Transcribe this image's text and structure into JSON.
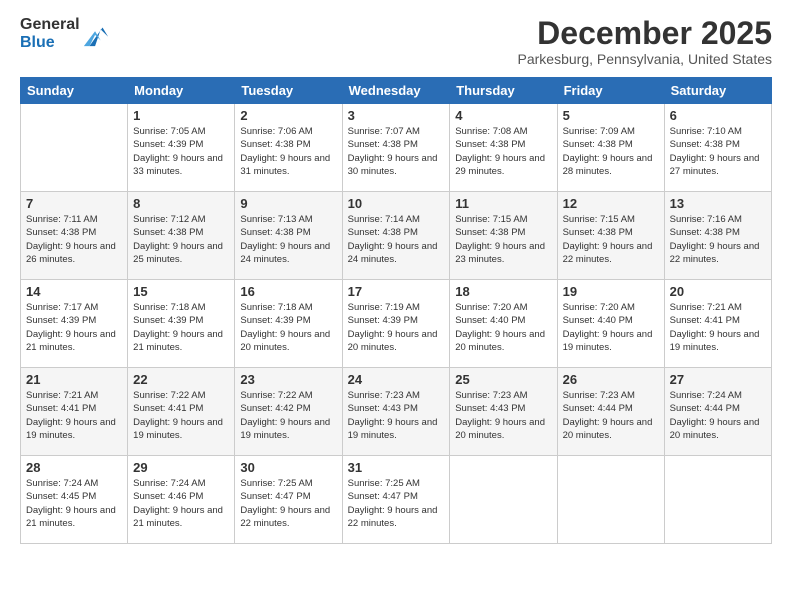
{
  "header": {
    "logo_line1": "General",
    "logo_line2": "Blue",
    "month": "December 2025",
    "location": "Parkesburg, Pennsylvania, United States"
  },
  "days_of_week": [
    "Sunday",
    "Monday",
    "Tuesday",
    "Wednesday",
    "Thursday",
    "Friday",
    "Saturday"
  ],
  "weeks": [
    [
      {
        "day": "",
        "sunrise": "",
        "sunset": "",
        "daylight": ""
      },
      {
        "day": "1",
        "sunrise": "Sunrise: 7:05 AM",
        "sunset": "Sunset: 4:39 PM",
        "daylight": "Daylight: 9 hours and 33 minutes."
      },
      {
        "day": "2",
        "sunrise": "Sunrise: 7:06 AM",
        "sunset": "Sunset: 4:38 PM",
        "daylight": "Daylight: 9 hours and 31 minutes."
      },
      {
        "day": "3",
        "sunrise": "Sunrise: 7:07 AM",
        "sunset": "Sunset: 4:38 PM",
        "daylight": "Daylight: 9 hours and 30 minutes."
      },
      {
        "day": "4",
        "sunrise": "Sunrise: 7:08 AM",
        "sunset": "Sunset: 4:38 PM",
        "daylight": "Daylight: 9 hours and 29 minutes."
      },
      {
        "day": "5",
        "sunrise": "Sunrise: 7:09 AM",
        "sunset": "Sunset: 4:38 PM",
        "daylight": "Daylight: 9 hours and 28 minutes."
      },
      {
        "day": "6",
        "sunrise": "Sunrise: 7:10 AM",
        "sunset": "Sunset: 4:38 PM",
        "daylight": "Daylight: 9 hours and 27 minutes."
      }
    ],
    [
      {
        "day": "7",
        "sunrise": "Sunrise: 7:11 AM",
        "sunset": "Sunset: 4:38 PM",
        "daylight": "Daylight: 9 hours and 26 minutes."
      },
      {
        "day": "8",
        "sunrise": "Sunrise: 7:12 AM",
        "sunset": "Sunset: 4:38 PM",
        "daylight": "Daylight: 9 hours and 25 minutes."
      },
      {
        "day": "9",
        "sunrise": "Sunrise: 7:13 AM",
        "sunset": "Sunset: 4:38 PM",
        "daylight": "Daylight: 9 hours and 24 minutes."
      },
      {
        "day": "10",
        "sunrise": "Sunrise: 7:14 AM",
        "sunset": "Sunset: 4:38 PM",
        "daylight": "Daylight: 9 hours and 24 minutes."
      },
      {
        "day": "11",
        "sunrise": "Sunrise: 7:15 AM",
        "sunset": "Sunset: 4:38 PM",
        "daylight": "Daylight: 9 hours and 23 minutes."
      },
      {
        "day": "12",
        "sunrise": "Sunrise: 7:15 AM",
        "sunset": "Sunset: 4:38 PM",
        "daylight": "Daylight: 9 hours and 22 minutes."
      },
      {
        "day": "13",
        "sunrise": "Sunrise: 7:16 AM",
        "sunset": "Sunset: 4:38 PM",
        "daylight": "Daylight: 9 hours and 22 minutes."
      }
    ],
    [
      {
        "day": "14",
        "sunrise": "Sunrise: 7:17 AM",
        "sunset": "Sunset: 4:39 PM",
        "daylight": "Daylight: 9 hours and 21 minutes."
      },
      {
        "day": "15",
        "sunrise": "Sunrise: 7:18 AM",
        "sunset": "Sunset: 4:39 PM",
        "daylight": "Daylight: 9 hours and 21 minutes."
      },
      {
        "day": "16",
        "sunrise": "Sunrise: 7:18 AM",
        "sunset": "Sunset: 4:39 PM",
        "daylight": "Daylight: 9 hours and 20 minutes."
      },
      {
        "day": "17",
        "sunrise": "Sunrise: 7:19 AM",
        "sunset": "Sunset: 4:39 PM",
        "daylight": "Daylight: 9 hours and 20 minutes."
      },
      {
        "day": "18",
        "sunrise": "Sunrise: 7:20 AM",
        "sunset": "Sunset: 4:40 PM",
        "daylight": "Daylight: 9 hours and 20 minutes."
      },
      {
        "day": "19",
        "sunrise": "Sunrise: 7:20 AM",
        "sunset": "Sunset: 4:40 PM",
        "daylight": "Daylight: 9 hours and 19 minutes."
      },
      {
        "day": "20",
        "sunrise": "Sunrise: 7:21 AM",
        "sunset": "Sunset: 4:41 PM",
        "daylight": "Daylight: 9 hours and 19 minutes."
      }
    ],
    [
      {
        "day": "21",
        "sunrise": "Sunrise: 7:21 AM",
        "sunset": "Sunset: 4:41 PM",
        "daylight": "Daylight: 9 hours and 19 minutes."
      },
      {
        "day": "22",
        "sunrise": "Sunrise: 7:22 AM",
        "sunset": "Sunset: 4:41 PM",
        "daylight": "Daylight: 9 hours and 19 minutes."
      },
      {
        "day": "23",
        "sunrise": "Sunrise: 7:22 AM",
        "sunset": "Sunset: 4:42 PM",
        "daylight": "Daylight: 9 hours and 19 minutes."
      },
      {
        "day": "24",
        "sunrise": "Sunrise: 7:23 AM",
        "sunset": "Sunset: 4:43 PM",
        "daylight": "Daylight: 9 hours and 19 minutes."
      },
      {
        "day": "25",
        "sunrise": "Sunrise: 7:23 AM",
        "sunset": "Sunset: 4:43 PM",
        "daylight": "Daylight: 9 hours and 20 minutes."
      },
      {
        "day": "26",
        "sunrise": "Sunrise: 7:23 AM",
        "sunset": "Sunset: 4:44 PM",
        "daylight": "Daylight: 9 hours and 20 minutes."
      },
      {
        "day": "27",
        "sunrise": "Sunrise: 7:24 AM",
        "sunset": "Sunset: 4:44 PM",
        "daylight": "Daylight: 9 hours and 20 minutes."
      }
    ],
    [
      {
        "day": "28",
        "sunrise": "Sunrise: 7:24 AM",
        "sunset": "Sunset: 4:45 PM",
        "daylight": "Daylight: 9 hours and 21 minutes."
      },
      {
        "day": "29",
        "sunrise": "Sunrise: 7:24 AM",
        "sunset": "Sunset: 4:46 PM",
        "daylight": "Daylight: 9 hours and 21 minutes."
      },
      {
        "day": "30",
        "sunrise": "Sunrise: 7:25 AM",
        "sunset": "Sunset: 4:47 PM",
        "daylight": "Daylight: 9 hours and 22 minutes."
      },
      {
        "day": "31",
        "sunrise": "Sunrise: 7:25 AM",
        "sunset": "Sunset: 4:47 PM",
        "daylight": "Daylight: 9 hours and 22 minutes."
      },
      {
        "day": "",
        "sunrise": "",
        "sunset": "",
        "daylight": ""
      },
      {
        "day": "",
        "sunrise": "",
        "sunset": "",
        "daylight": ""
      },
      {
        "day": "",
        "sunrise": "",
        "sunset": "",
        "daylight": ""
      }
    ]
  ]
}
